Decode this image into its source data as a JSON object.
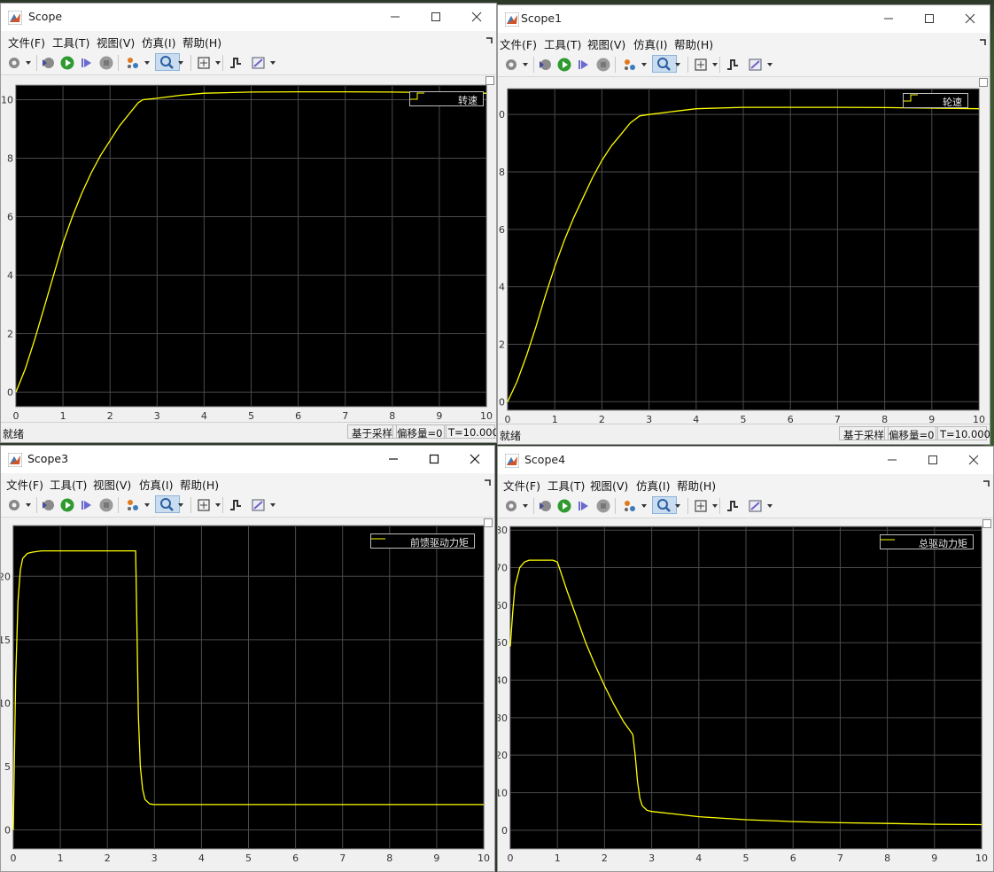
{
  "menu": [
    "文件(F)",
    "工具(T)",
    "视图(V)",
    "仿真(I)",
    "帮助(H)"
  ],
  "status": {
    "ready": "就绪",
    "sample": "基于采样",
    "offset": "偏移量=0",
    "time": "T=10.000"
  },
  "colors": {
    "trace": "#ffff00",
    "grid": "#4a4a4a",
    "axes_bg": "#000000",
    "tick": "#333333"
  },
  "icons": [
    "settings-gear-icon",
    "step-back-icon",
    "run-icon",
    "step-forward-icon",
    "stop-icon",
    "signal-selector-icon",
    "zoom-icon",
    "autoscale-icon",
    "triggers-icon",
    "measure-icon"
  ],
  "windows": [
    {
      "title": "Scope",
      "legend": "转速",
      "ylim": [
        -0.5,
        10.5
      ],
      "yticks": [
        "0",
        "2",
        "4",
        "6",
        "8",
        "10"
      ],
      "ytick_vals": [
        0,
        2,
        4,
        6,
        8,
        10
      ],
      "xticks": [
        "0",
        "1",
        "2",
        "3",
        "4",
        "5",
        "6",
        "7",
        "8",
        "9",
        "10"
      ],
      "chart_data": {
        "type": "line",
        "xlabel": "",
        "ylabel": "",
        "xlim": [
          0,
          10
        ],
        "ylim": [
          -0.5,
          10.5
        ],
        "grid": true,
        "legend_placement": "top-right",
        "series": [
          {
            "name": "转速",
            "x": [
              0,
              0.2,
              0.4,
              0.6,
              0.8,
              1.0,
              1.2,
              1.4,
              1.6,
              1.8,
              2.0,
              2.2,
              2.4,
              2.6,
              2.7,
              3.0,
              3.5,
              4.0,
              5.0,
              6.0,
              7.0,
              8.0,
              9.0,
              10.0
            ],
            "y": [
              0,
              0.8,
              1.8,
              2.9,
              4.0,
              5.1,
              6.0,
              6.8,
              7.5,
              8.1,
              8.6,
              9.1,
              9.5,
              9.9,
              10.0,
              10.05,
              10.15,
              10.22,
              10.26,
              10.27,
              10.27,
              10.26,
              10.24,
              10.22
            ]
          }
        ]
      }
    },
    {
      "title": "Scope1",
      "legend": "轮速",
      "ylim": [
        -0.3,
        10.9
      ],
      "yticks": [
        "0",
        "2",
        "4",
        "6",
        "8",
        "10"
      ],
      "ytick_vals": [
        0,
        2,
        4,
        6,
        8,
        10
      ],
      "xticks": [
        "0",
        "1",
        "2",
        "3",
        "4",
        "5",
        "6",
        "7",
        "8",
        "9",
        "10"
      ],
      "chart_data": {
        "type": "line",
        "xlabel": "",
        "ylabel": "",
        "xlim": [
          0,
          10
        ],
        "ylim": [
          -0.3,
          10.9
        ],
        "grid": true,
        "legend_placement": "top-right",
        "series": [
          {
            "name": "轮速",
            "x": [
              0,
              0.2,
              0.4,
              0.6,
              0.8,
              1.0,
              1.2,
              1.4,
              1.6,
              1.8,
              2.0,
              2.2,
              2.4,
              2.6,
              2.8,
              3.0,
              3.5,
              4.0,
              5.0,
              6.0,
              7.0,
              8.0,
              9.0,
              10.0
            ],
            "y": [
              0,
              0.7,
              1.6,
              2.6,
              3.7,
              4.7,
              5.6,
              6.4,
              7.1,
              7.8,
              8.4,
              8.9,
              9.3,
              9.7,
              9.95,
              10.0,
              10.1,
              10.2,
              10.25,
              10.25,
              10.25,
              10.24,
              10.22,
              10.2
            ]
          }
        ]
      }
    },
    {
      "title": "Scope3",
      "legend": "前馈驱动力矩",
      "ylim": [
        -1.5,
        24.0
      ],
      "yticks": [
        "0",
        "5",
        "10",
        "15",
        "20"
      ],
      "ytick_vals": [
        0,
        5,
        10,
        15,
        20
      ],
      "xticks": [
        "0",
        "1",
        "2",
        "3",
        "4",
        "5",
        "6",
        "7",
        "8",
        "9",
        "10"
      ],
      "chart_data": {
        "type": "line",
        "xlabel": "",
        "ylabel": "",
        "xlim": [
          0,
          10
        ],
        "ylim": [
          -1.5,
          24.0
        ],
        "grid": true,
        "legend_placement": "top-right",
        "series": [
          {
            "name": "前馈驱动力矩",
            "x": [
              0,
              0.05,
              0.1,
              0.15,
              0.2,
              0.3,
              0.4,
              0.6,
              1.0,
              2.0,
              2.6,
              2.62,
              2.66,
              2.7,
              2.75,
              2.8,
              2.9,
              3.0,
              3.5,
              4.0,
              6.0,
              8.0,
              10.0
            ],
            "y": [
              0,
              12,
              18,
              20.5,
              21.4,
              21.8,
              21.9,
              22.0,
              22.0,
              22.0,
              22.0,
              18,
              9,
              5,
              3.2,
              2.4,
              2.05,
              2.0,
              2.0,
              2.0,
              2.0,
              2.0,
              2.0
            ]
          }
        ]
      }
    },
    {
      "title": "Scope4",
      "legend": "总驱动力矩",
      "ylim": [
        -5,
        81
      ],
      "yticks": [
        "0",
        "10",
        "20",
        "30",
        "40",
        "50",
        "60",
        "70",
        "80"
      ],
      "ytick_vals": [
        0,
        10,
        20,
        30,
        40,
        50,
        60,
        70,
        80
      ],
      "xticks": [
        "0",
        "1",
        "2",
        "3",
        "4",
        "5",
        "6",
        "7",
        "8",
        "9",
        "10"
      ],
      "chart_data": {
        "type": "line",
        "xlabel": "",
        "ylabel": "",
        "xlim": [
          0,
          10
        ],
        "ylim": [
          -5,
          81
        ],
        "grid": true,
        "legend_placement": "top-right",
        "series": [
          {
            "name": "总驱动力矩",
            "x": [
              0,
              0.05,
              0.1,
              0.2,
              0.3,
              0.4,
              0.6,
              0.9,
              1.0,
              1.2,
              1.4,
              1.6,
              1.8,
              2.0,
              2.2,
              2.4,
              2.6,
              2.65,
              2.7,
              2.75,
              2.8,
              2.9,
              3.0,
              3.5,
              4.0,
              5.0,
              6.0,
              7.0,
              8.0,
              9.0,
              10.0
            ],
            "y": [
              49,
              58,
              65,
              70,
              71.5,
              72,
              72,
              72,
              71.5,
              64,
              57,
              50,
              44,
              38.5,
              33.5,
              29,
              25.5,
              20,
              13,
              8.5,
              6.5,
              5.3,
              5.0,
              4.3,
              3.6,
              2.8,
              2.3,
              2.0,
              1.8,
              1.6,
              1.5
            ]
          }
        ]
      }
    }
  ]
}
